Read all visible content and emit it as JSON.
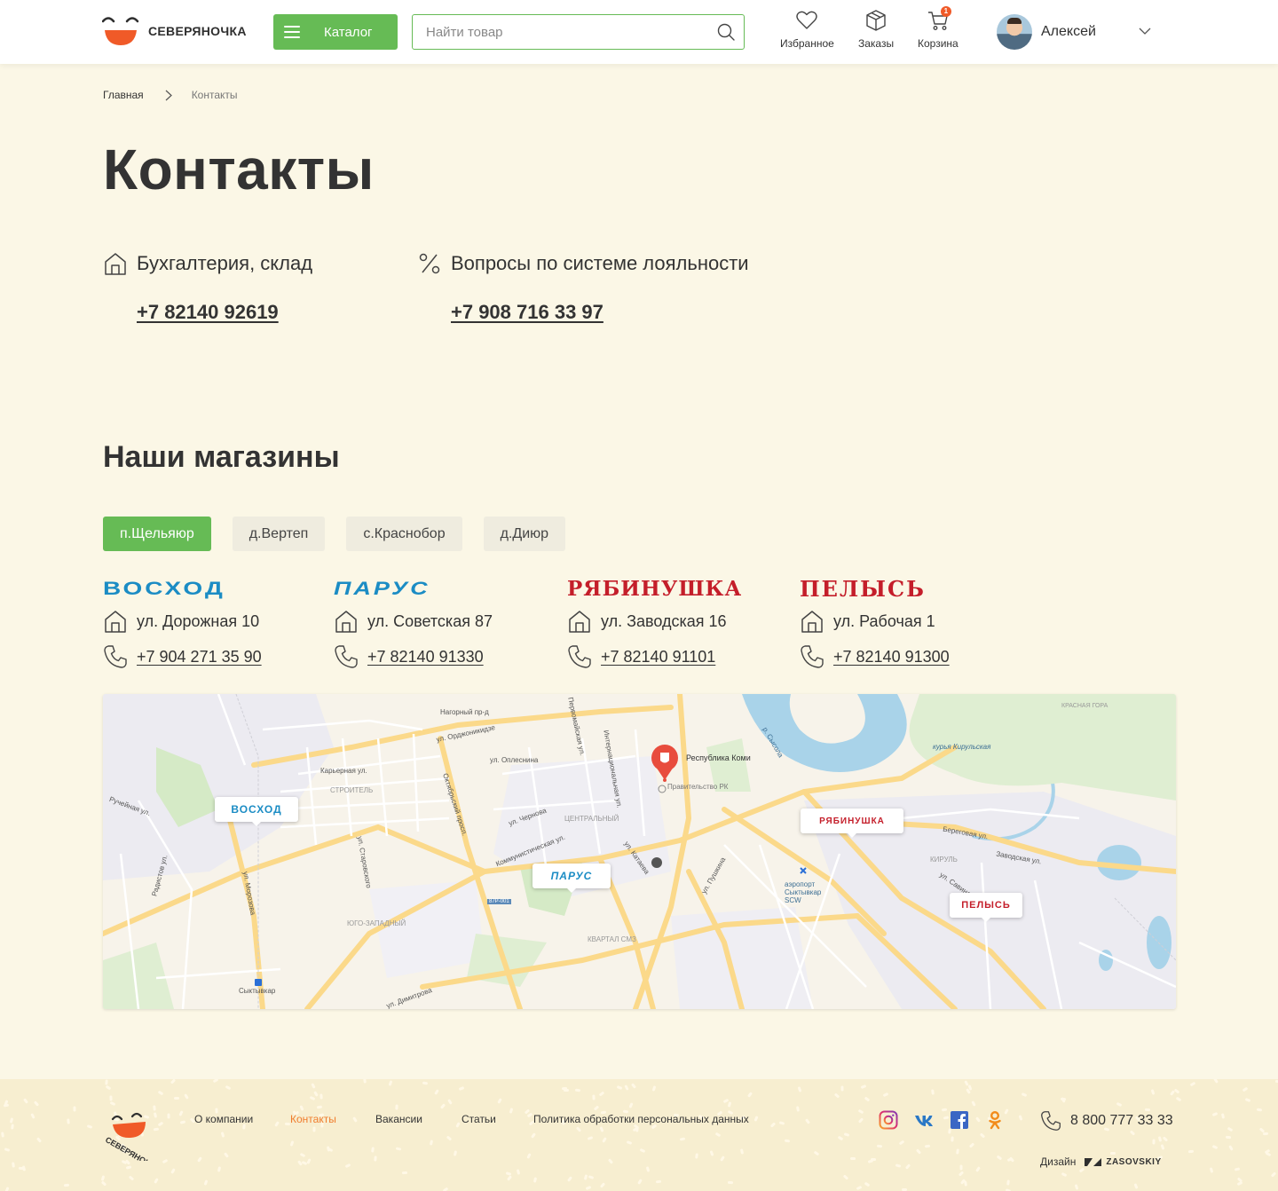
{
  "header": {
    "brand": "СЕВЕРЯНОЧКА",
    "catalog_label": "Каталог",
    "search_placeholder": "Найти товар",
    "nav": [
      {
        "label": "Избранное",
        "icon": "heart-icon"
      },
      {
        "label": "Заказы",
        "icon": "box-icon"
      },
      {
        "label": "Корзина",
        "icon": "cart-icon",
        "badge": "1"
      }
    ],
    "user_name": "Алексей"
  },
  "breadcrumb": {
    "home": "Главная",
    "current": "Контакты"
  },
  "page_title": "Контакты",
  "contacts": [
    {
      "title": "Бухгалтерия, склад",
      "phone": "+7 82140 92619",
      "icon": "house-icon"
    },
    {
      "title": "Вопросы по системе лояльности",
      "phone": "+7 908 716 33 97",
      "icon": "percent-icon"
    }
  ],
  "stores_title": "Наши магазины",
  "tabs": [
    "п.Щельяюр",
    "д.Вертеп",
    "с.Краснобор",
    "д.Диюр"
  ],
  "active_tab": 0,
  "stores": [
    {
      "logo": "ВОСХОД",
      "address": "ул. Дорожная 10",
      "phone": "+7 904 271 35 90",
      "color": "#1b8cc4"
    },
    {
      "logo": "ПАРУС",
      "address": "ул. Советская 87",
      "phone": "+7 82140 91330",
      "color": "#1b8cc4"
    },
    {
      "logo": "РЯБИНУШКА",
      "address": "ул. Заводская 16",
      "phone": "+7 82140 91101",
      "color": "#c41e2a"
    },
    {
      "logo": "ПЕЛЫСЬ",
      "address": "ул. Рабочая 1",
      "phone": "+7 82140 91300",
      "color": "#c41e2a"
    }
  ],
  "map": {
    "markers": [
      "ВОСХОД",
      "ПАРУС",
      "РЯБИНУШКА",
      "ПЕЛЫСЬ"
    ],
    "poi": "Республика Коми",
    "labels": [
      "Нагорный пр-д",
      "ул. Орджоникидзе",
      "Первомайская ул.",
      "ул. Оплеснина",
      "Карьерная ул.",
      "СТРОИТЕЛЬ",
      "Октябрьский просп.",
      "Интернациональная ул.",
      "ул. Морозова",
      "ул. Старовского",
      "Коммунистическая ул.",
      "ЦЕНТРАЛЬНЫЙ",
      "ул. Чернова",
      "ул. Пушкина",
      "ул. Катаева",
      "ЮГО-ЗАПАДНЫЙ",
      "КВАРТАЛ СМЗ",
      "р. Сысола",
      "курья Кирульская",
      "аэропорт Сыктывкар SCW",
      "Правительство РК",
      "ул. Савина",
      "КИРУЛЬ",
      "КРАСНАЯ ГОРА",
      "Ручейная ул.",
      "Радистов ул.",
      "Сыктывкар",
      "ул. Димитрова",
      "Береговая ул.",
      "Заводская ул.",
      "87Р-001"
    ]
  },
  "footer": {
    "brand": "СЕВЕРЯНОЧКА",
    "nav": [
      "О компании",
      "Контакты",
      "Вакансии",
      "Статьи",
      "Политика обработки персональных данных"
    ],
    "active_nav": 1,
    "social": [
      "instagram-icon",
      "vk-icon",
      "facebook-icon",
      "odnoklassniki-icon"
    ],
    "phone": "8 800 777 33 33",
    "design_label": "Дизайн",
    "design_studio": "ZASOVSKIY"
  },
  "colors": {
    "accent": "#66bb55",
    "background": "#fbf7e6",
    "footer": "#f7eed0",
    "active_link": "#f07d2e",
    "brand_orange": "#f05a28"
  }
}
